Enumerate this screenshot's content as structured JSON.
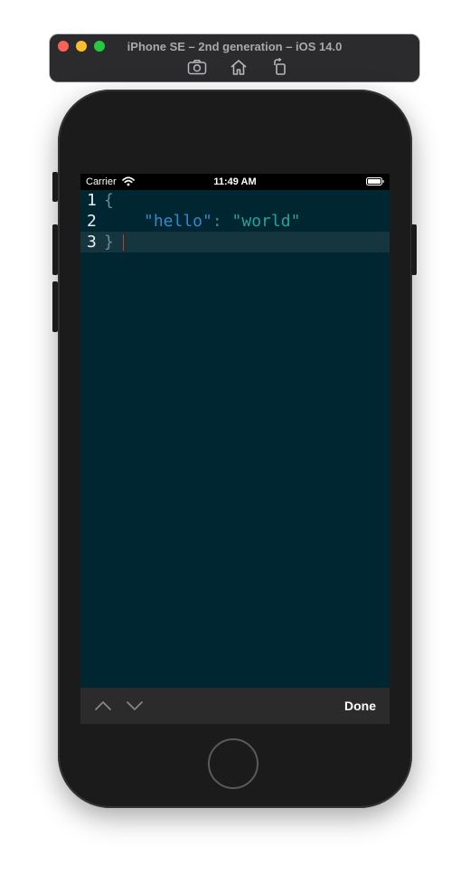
{
  "simulator": {
    "title": "iPhone SE – 2nd generation – iOS 14.0",
    "toolbar": {
      "screenshot_icon": "camera-icon",
      "home_icon": "home-icon",
      "rotate_icon": "rotate-icon"
    }
  },
  "status_bar": {
    "carrier": "Carrier",
    "time": "11:49 AM",
    "wifi_icon": "wifi-icon",
    "battery_icon": "battery-icon"
  },
  "editor": {
    "lines": [
      {
        "number": "1",
        "brace": "{"
      },
      {
        "number": "2",
        "key": "\"hello\"",
        "colon": ":",
        "value": "\"world\""
      },
      {
        "number": "3",
        "brace": "}"
      }
    ],
    "current_line": 3,
    "colors": {
      "background": "#002632",
      "current_line": "#15363e",
      "key": "#3a86c8",
      "string": "#2aa198",
      "caret": "#c43a2e"
    }
  },
  "accessory_bar": {
    "prev_icon": "chevron-up-icon",
    "next_icon": "chevron-down-icon",
    "done_label": "Done"
  }
}
